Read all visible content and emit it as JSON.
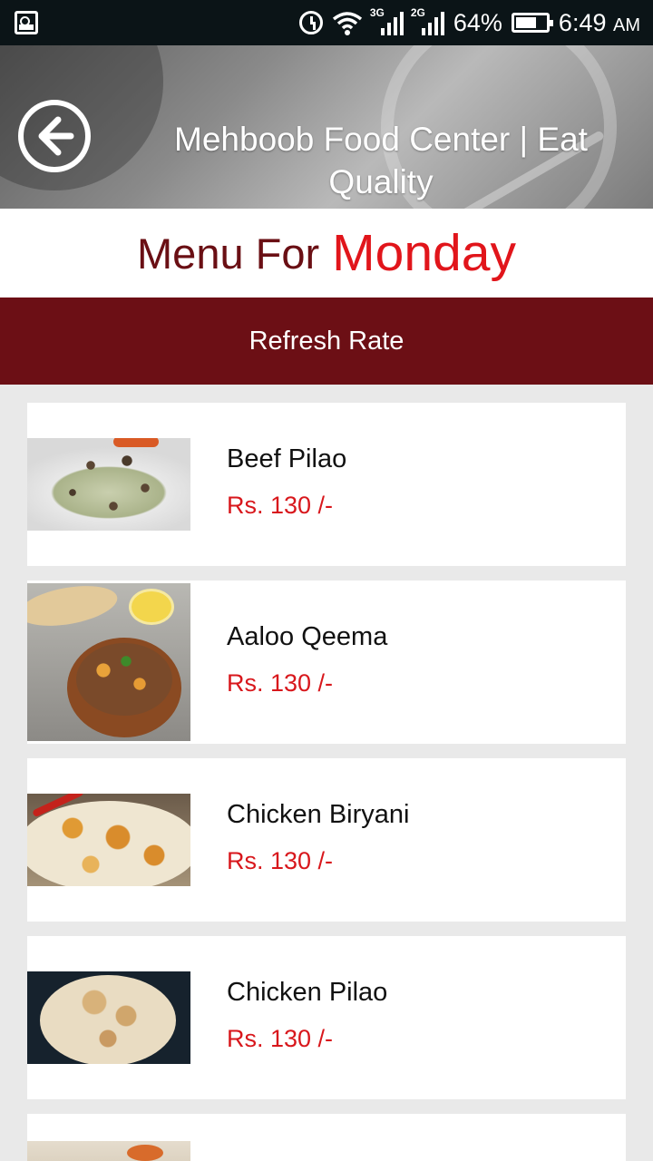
{
  "status_bar": {
    "network_3g": "3G",
    "network_2g": "2G",
    "battery_percent": "64%",
    "time": "6:49",
    "ampm": "AM",
    "icons": [
      "gallery-icon",
      "alarm-icon",
      "wifi-icon",
      "signal-icon",
      "battery-icon"
    ]
  },
  "header": {
    "title_line1": "Mehboob Food Center | Eat",
    "title_line2": "Quality",
    "back_icon": "arrow-left-icon"
  },
  "menu": {
    "prefix": "Menu For",
    "day": "Monday"
  },
  "refresh_button": {
    "label": "Refresh Rate"
  },
  "items": [
    {
      "name": "Beef Pilao",
      "price": "Rs. 130 /-"
    },
    {
      "name": "Aaloo Qeema",
      "price": "Rs. 130 /-"
    },
    {
      "name": "Chicken Biryani",
      "price": "Rs. 130 /-"
    },
    {
      "name": "Chicken Pilao",
      "price": "Rs. 130 /-"
    }
  ],
  "colors": {
    "primary_dark_red": "#6c0f15",
    "accent_red": "#e1151b",
    "price_red": "#d8171c"
  }
}
